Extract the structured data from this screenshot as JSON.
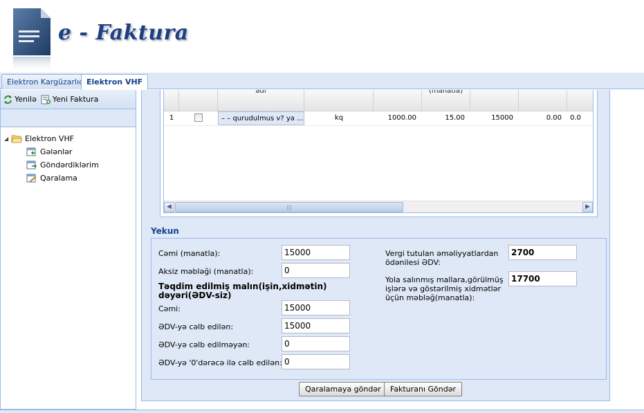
{
  "header": {
    "brand": "e - Faktura"
  },
  "tabs": [
    {
      "label": "Elektron Kargüzarlıq",
      "active": false
    },
    {
      "label": "Elektron VHF",
      "active": true
    }
  ],
  "toolbar": {
    "refresh_label": "Yenilə",
    "new_invoice_label": "Yeni Faktura"
  },
  "tree": {
    "root": "Elektron VHF",
    "children": [
      "Gələnlər",
      "Göndərdiklərim",
      "Qaralama"
    ]
  },
  "grid": {
    "headers": [
      "",
      "",
      "adı",
      "",
      "",
      "(manatla)",
      "",
      "",
      ""
    ],
    "rows": [
      {
        "num": "1",
        "name": "– – qurudulmus v? ya ...",
        "unit": "kq",
        "qty": "1000.00",
        "price": "15.00",
        "amount": "15000",
        "c7": "0.00",
        "c8": "0.0"
      }
    ],
    "scroll_thumb": "|||"
  },
  "yekun": {
    "title": "Yekun",
    "cemi_label": "Cəmi (manatla):",
    "cemi_value": "15000",
    "aksiz_label": "Aksiz məbləği (manatla):",
    "aksiz_value": "0",
    "section_label": "Təqdim edilmiş malın(işin,xidmətin) dəyəri(ƏDV-siz)",
    "cemi2_label": "Cəmi:",
    "cemi2_value": "15000",
    "edv_celb_label": "ƏDV-yə cəlb edilən:",
    "edv_celb_value": "15000",
    "edv_celb_olmayan_label": "ƏDV-yə cəlb edilməyən:",
    "edv_celb_olmayan_value": "0",
    "edv_sifir_label": "ƏDV-yə '0'dərəcə ilə cəlb edilən:",
    "edv_sifir_value": "0",
    "vergi_label": "Vergi tutulan əməliyyatlardan ödənilesi ƏDV:",
    "vergi_value": "2700",
    "yola_label": "Yola salınmış mallara,görülmüş işlərə və göstərilmiş xidmətlər üçün məbləğ(manatla):",
    "yola_value": "17700"
  },
  "buttons": {
    "draft": "Qaralamaya göndər",
    "send": "Fakturanı Göndər"
  },
  "colors": {
    "brand": "#1f3f7f",
    "panel": "#dfe8f6",
    "border": "#99bbe8"
  }
}
